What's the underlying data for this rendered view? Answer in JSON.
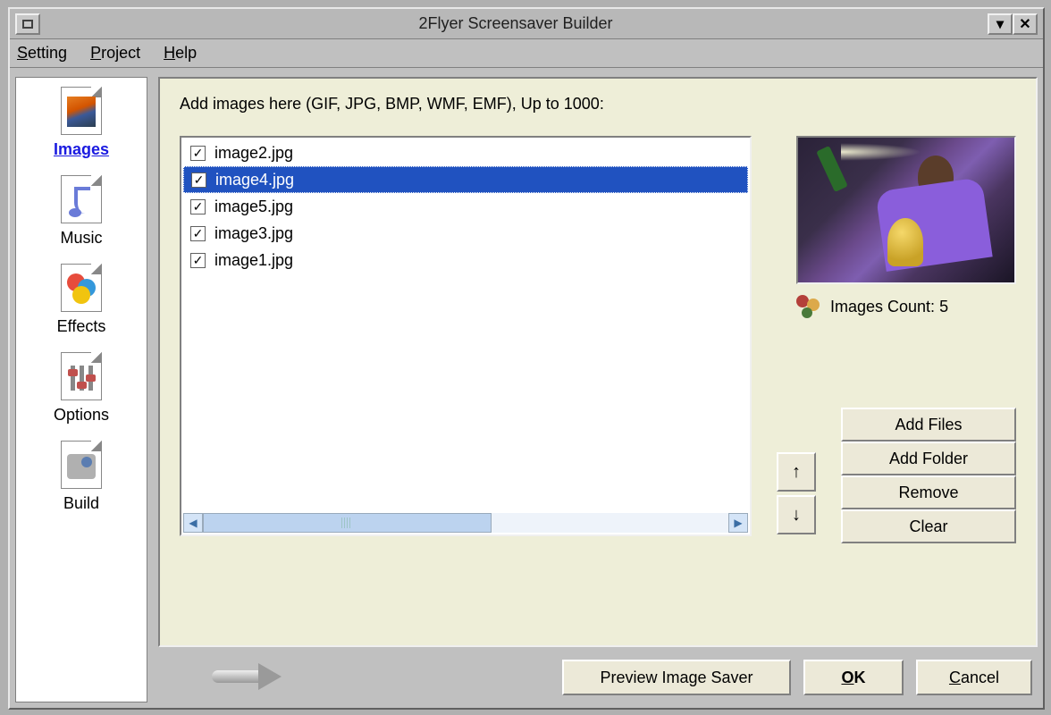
{
  "window": {
    "title": "2Flyer Screensaver Builder"
  },
  "menu": {
    "setting": "Setting",
    "project": "Project",
    "help": "Help"
  },
  "sidebar": {
    "items": [
      {
        "label": "Images",
        "active": true
      },
      {
        "label": "Music"
      },
      {
        "label": "Effects"
      },
      {
        "label": "Options"
      },
      {
        "label": "Build"
      }
    ]
  },
  "main": {
    "instruction": "Add images here (GIF, JPG, BMP, WMF, EMF), Up to 1000:",
    "files": [
      {
        "name": "image2.jpg",
        "checked": true,
        "selected": false
      },
      {
        "name": "image4.jpg",
        "checked": true,
        "selected": true
      },
      {
        "name": "image5.jpg",
        "checked": true,
        "selected": false
      },
      {
        "name": "image3.jpg",
        "checked": true,
        "selected": false
      },
      {
        "name": "image1.jpg",
        "checked": true,
        "selected": false
      }
    ],
    "count_label": "Images Count: 5",
    "buttons": {
      "add_files": "Add Files",
      "add_folder": "Add Folder",
      "remove": "Remove",
      "clear": "Clear"
    }
  },
  "footer": {
    "preview": "Preview Image Saver",
    "ok": "OK",
    "cancel": "Cancel"
  }
}
